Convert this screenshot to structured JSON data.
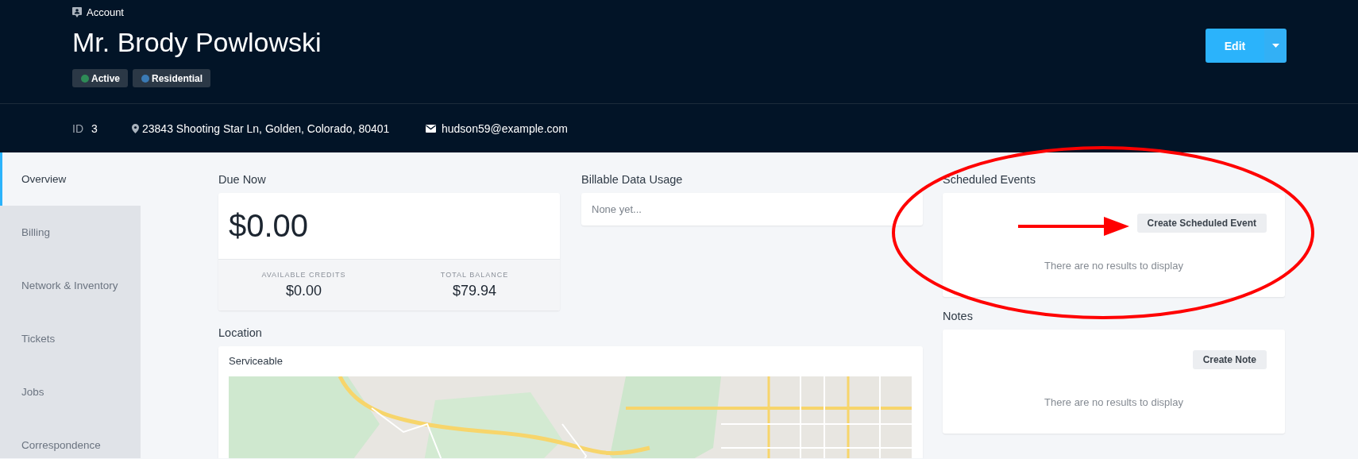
{
  "header": {
    "section": "Account",
    "title": "Mr. Brody Powlowski",
    "badges": [
      {
        "label": "Active",
        "color": "#2e8b57"
      },
      {
        "label": "Residential",
        "color": "#3a7ab5"
      }
    ],
    "edit_button": {
      "label": "Edit"
    },
    "info": {
      "id_label": "ID",
      "id_value": "3",
      "address": "23843 Shooting Star Ln, Golden, Colorado, 80401",
      "email": "hudson59@example.com"
    }
  },
  "sidebar": {
    "items": [
      {
        "label": "Overview",
        "selected": true
      },
      {
        "label": "Billing",
        "selected": false
      },
      {
        "label": "Network & Inventory",
        "selected": false
      },
      {
        "label": "Tickets",
        "selected": false
      },
      {
        "label": "Jobs",
        "selected": false
      },
      {
        "label": "Correspondence",
        "selected": false
      }
    ]
  },
  "due_now": {
    "title": "Due Now",
    "amount": "$0.00",
    "stats": [
      {
        "label": "AVAILABLE CREDITS",
        "value": "$0.00"
      },
      {
        "label": "TOTAL BALANCE",
        "value": "$79.94"
      }
    ]
  },
  "billable_data_usage": {
    "title": "Billable Data Usage",
    "text": "None yet..."
  },
  "location": {
    "title": "Location",
    "status": "Serviceable"
  },
  "scheduled_events": {
    "title": "Scheduled Events",
    "button": "Create Scheduled Event",
    "empty_text": "There are no results to display"
  },
  "notes": {
    "title": "Notes",
    "button": "Create Note",
    "empty_text": "There are no results to display"
  },
  "annotations": [
    {
      "kind": "ellipse"
    },
    {
      "kind": "arrow"
    }
  ]
}
